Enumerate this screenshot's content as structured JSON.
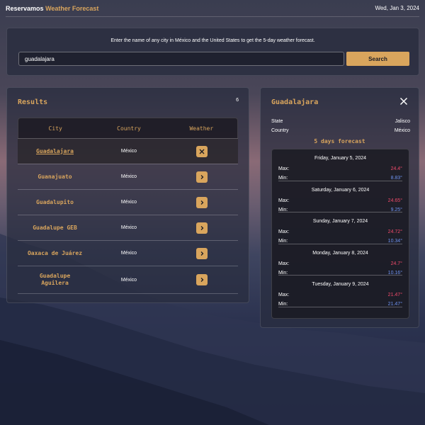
{
  "header": {
    "brand_main": "Reservamos",
    "brand_accent": "Weather Forecast",
    "date": "Wed, Jan 3, 2024"
  },
  "search": {
    "hint": "Enter the name of any city in México and the United States to get the 5-day weather forecast.",
    "value": "guadalajara",
    "button_label": "Search"
  },
  "results": {
    "title": "Results",
    "count": "6",
    "columns": [
      "City",
      "Country",
      "Weather"
    ],
    "rows": [
      {
        "city": "Guadalajara",
        "country": "México",
        "active": true
      },
      {
        "city": "Guanajuato",
        "country": "México",
        "active": false
      },
      {
        "city": "Guadalupito",
        "country": "México",
        "active": false
      },
      {
        "city": "Guadalupe GEB",
        "country": "México",
        "active": false
      },
      {
        "city": "Oaxaca de Juárez",
        "country": "México",
        "active": false
      },
      {
        "city": "Guadalupe Aguilera",
        "country": "México",
        "active": false
      }
    ]
  },
  "forecast": {
    "city": "Guadalajara",
    "state_label": "State",
    "state_value": "Jalisco",
    "country_label": "Country",
    "country_value": "México",
    "title": "5 days forecast",
    "max_label": "Max:",
    "min_label": "Min:",
    "days": [
      {
        "date": "Friday, January 5, 2024",
        "max": "24.4°",
        "min": "8.83°"
      },
      {
        "date": "Saturday, January 6, 2024",
        "max": "24.65°",
        "min": "9.25°"
      },
      {
        "date": "Sunday, January 7, 2024",
        "max": "24.72°",
        "min": "10.34°"
      },
      {
        "date": "Monday, January 8, 2024",
        "max": "24.7°",
        "min": "10.16°"
      },
      {
        "date": "Tuesday, January 9, 2024",
        "max": "21.47°",
        "min": "21.47°"
      }
    ]
  },
  "colors": {
    "accent": "#d9a55d",
    "max_temp": "#ef4a6a",
    "min_temp": "#6e92ef"
  },
  "icons": {
    "close": "close-icon",
    "row_selected": "close-icon",
    "row_action": "chevron-right-icon"
  }
}
